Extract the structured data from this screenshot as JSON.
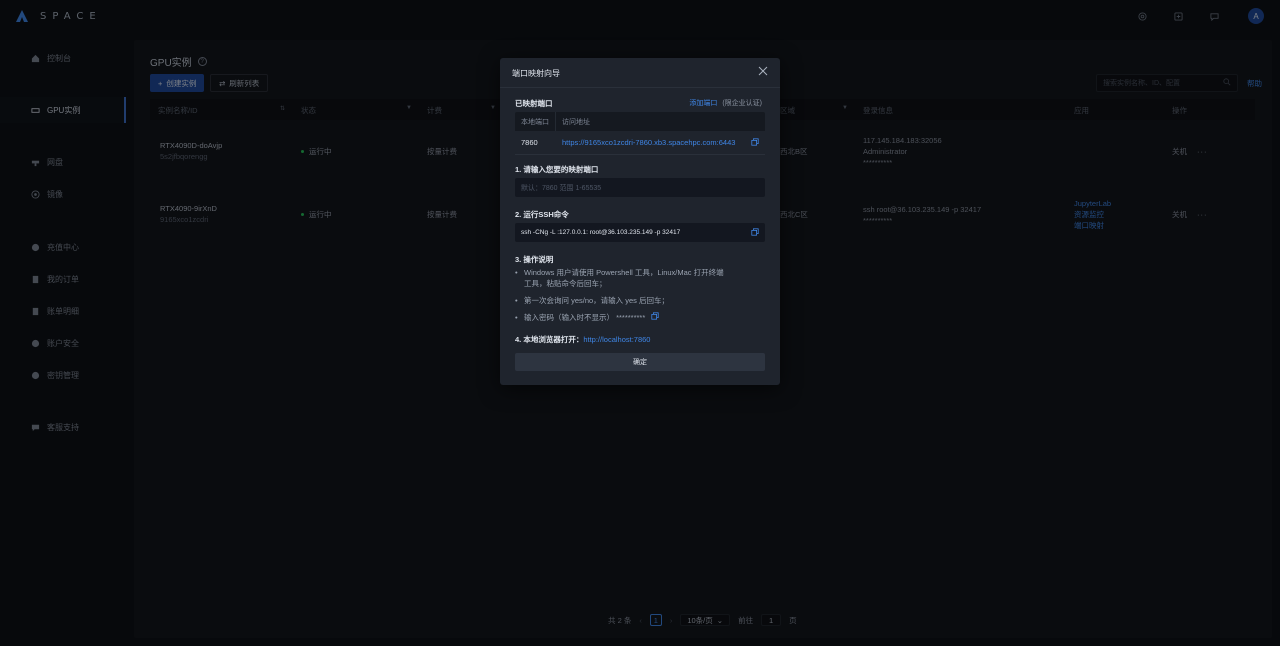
{
  "app": {
    "logo_text": "SPACE",
    "avatar_letter": "A"
  },
  "sidebar": {
    "items": [
      {
        "label": "控制台",
        "icon": "home-icon"
      },
      {
        "label": "GPU实例",
        "icon": "gpu-icon"
      },
      {
        "label": "网盘",
        "icon": "drive-icon"
      },
      {
        "label": "镜像",
        "icon": "image-icon"
      },
      {
        "label": "充值中心",
        "icon": "wallet-icon"
      },
      {
        "label": "我的订单",
        "icon": "order-icon"
      },
      {
        "label": "账单明细",
        "icon": "bill-icon"
      },
      {
        "label": "账户安全",
        "icon": "shield-icon"
      },
      {
        "label": "密钥管理",
        "icon": "key-icon"
      },
      {
        "label": "客服支持",
        "icon": "chat-icon"
      }
    ]
  },
  "main": {
    "title": "GPU实例",
    "create_button": "创建实例",
    "refresh_button": "刷新列表",
    "search_placeholder": "搜索实例名称、ID、配置",
    "help_link": "帮助",
    "columns": [
      "实例名称/ID",
      "状态",
      "计费",
      "区域",
      "登录信息",
      "应用",
      "操作"
    ],
    "rows": [
      {
        "name": "RTX4090D-doAvjp",
        "id": "5s2jfbqorengg",
        "status": "运行中",
        "billing": "按量计费",
        "region": "西北B区",
        "login_line1": "117.145.184.183:32056",
        "login_line2": "Administrator",
        "login_line3": "**********",
        "apps": [],
        "action": "关机",
        "more": "···"
      },
      {
        "name": "RTX4090-9irXnD",
        "id": "9165xco1zcdri",
        "status": "运行中",
        "billing": "按量计费",
        "region": "西北C区",
        "login_line1": "ssh root@36.103.235.149 -p 32417",
        "login_line2": "**********",
        "login_line3": "",
        "apps": [
          "JupyterLab",
          "资源监控",
          "端口映射"
        ],
        "action": "关机",
        "more": "···"
      }
    ],
    "pager": {
      "total": "共 2 条",
      "current_page": "1",
      "page_size": "10条/页",
      "goto_label": "前往",
      "goto_value": "1",
      "page_suffix": "页"
    }
  },
  "modal": {
    "title": "端口映射向导",
    "mapped_label": "已映射端口",
    "add_port_link": "添加端口",
    "add_port_note": "(限企业认证)",
    "table_head_local": "本地端口",
    "table_head_url": "访问地址",
    "port": "7860",
    "url": "https://9165xco1zcdri-7860.xb3.spacehpc.com:6443",
    "step1_label": "1. 请输入您要的映射端口",
    "step1_placeholder": "默认：7860 范围 1-65535",
    "step2_label": "2. 运行SSH命令",
    "step2_command": "ssh -CNg -L :127.0.0.1: root@36.103.235.149 -p 32417",
    "step3_label": "3. 操作说明",
    "step3_bullets": [
      "Windows 用户请使用 Powershell 工具，Linux/Mac 打开终端工具，粘贴命令后回车；",
      "第一次会询问 yes/no，请输入 yes 后回车；",
      "输入密码（输入时不显示） **********"
    ],
    "step4_label": "4. 本地浏览器打开：",
    "step4_link": "http://localhost:7860",
    "confirm_button": "确定"
  },
  "colors": {
    "accent": "#3f86e6",
    "primary_button": "#1f4a9b",
    "status_running": "#27c05a"
  }
}
